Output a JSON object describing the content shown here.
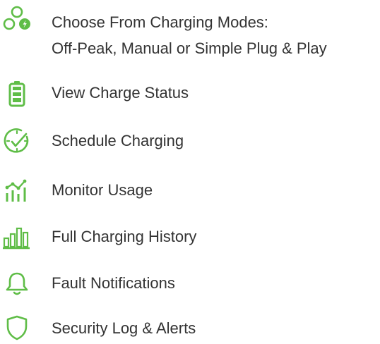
{
  "accent_color": "#5fbd47",
  "features": [
    {
      "icon": "charging-modes-icon",
      "lines": [
        "Choose From Charging Modes:",
        "Off-Peak, Manual or Simple Plug & Play"
      ]
    },
    {
      "icon": "battery-icon",
      "label": "View Charge Status"
    },
    {
      "icon": "clock-check-icon",
      "label": "Schedule Charging"
    },
    {
      "icon": "usage-chart-icon",
      "label": "Monitor Usage"
    },
    {
      "icon": "bar-chart-icon",
      "label": "Full Charging History"
    },
    {
      "icon": "bell-icon",
      "label": "Fault Notifications"
    },
    {
      "icon": "shield-icon",
      "label": "Security Log & Alerts"
    }
  ]
}
